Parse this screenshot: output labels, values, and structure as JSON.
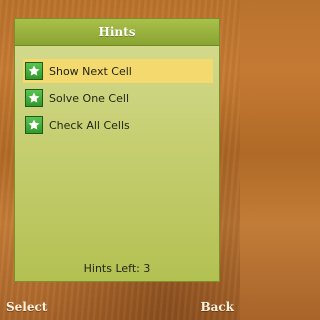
{
  "dialog": {
    "title": "Hints",
    "items": [
      {
        "label": "Show Next Cell",
        "selected": true,
        "icon": "star-icon"
      },
      {
        "label": "Solve One Cell",
        "selected": false,
        "icon": "star-icon"
      },
      {
        "label": "Check All Cells",
        "selected": false,
        "icon": "star-icon"
      }
    ],
    "hints_left": "Hints Left: 3"
  },
  "softkeys": {
    "left": "Select",
    "right": "Back"
  },
  "colors": {
    "panel": "#c7cf73",
    "header": "#9bb43c",
    "selection": "#f4d96f",
    "icon": "#3aa532",
    "background_wood": "#b9722d"
  }
}
